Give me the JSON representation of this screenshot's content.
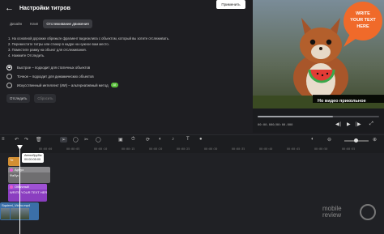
{
  "header": {
    "back_icon": "arrow-left-icon",
    "title": "Настройки титров",
    "apply_label": "Применить"
  },
  "tabs": [
    {
      "label": "Дизайн",
      "active": false
    },
    {
      "label": "Клип",
      "active": false
    },
    {
      "label": "Отслеживание движения",
      "active": true
    }
  ],
  "instructions": [
    "1. На основной дорожке обрежьте фрагмент видеоклипа с объектом, который вы хотите отслеживать.",
    "2. Переместите титры или стикер в кадре на нужное вам место.",
    "3. Поместите рамку на объект для отслеживания.",
    "4. Нажмите Отследить."
  ],
  "options": [
    {
      "label": "Быстрое – подходит для статичных объектов",
      "selected": true
    },
    {
      "label": "Точное – подходит для динамических объектов",
      "selected": false
    },
    {
      "label": "Искусственный интеллект (ИИ) – альтернативный метод",
      "selected": false,
      "badge": "AI"
    }
  ],
  "buttons": {
    "track": "Отследить",
    "reset": "Сбросить"
  },
  "preview": {
    "bubble_text": [
      "WRITE",
      "YOUR TEXT",
      "HERE"
    ],
    "caption": "Но видео прикольное",
    "timecode": "00:00.000/00:00.000",
    "progress": 0.62,
    "colors": {
      "bubble": "#f06a2a",
      "caption_bg": "#000000"
    }
  },
  "timeline": {
    "ticks": [
      "00:00:00",
      "00:00:05",
      "00:00:10",
      "00:00:15",
      "00:00:20",
      "00:00:25",
      "00:00:30",
      "00:00:35",
      "00:00:40",
      "00:00:45",
      "00:00:50",
      "00:00:55"
    ],
    "tooltip": [
      "Автообрубы",
      "00:00:05:00"
    ],
    "clips": {
      "text": "Те",
      "sticker": "Арбуз",
      "sticker_sub": "Фабус",
      "title": "Обычный",
      "title_sub": "WRITE YOUR TEXT HER",
      "video": "Squirrel_Video.mp4"
    }
  },
  "watermark": [
    "mobile",
    "review"
  ]
}
